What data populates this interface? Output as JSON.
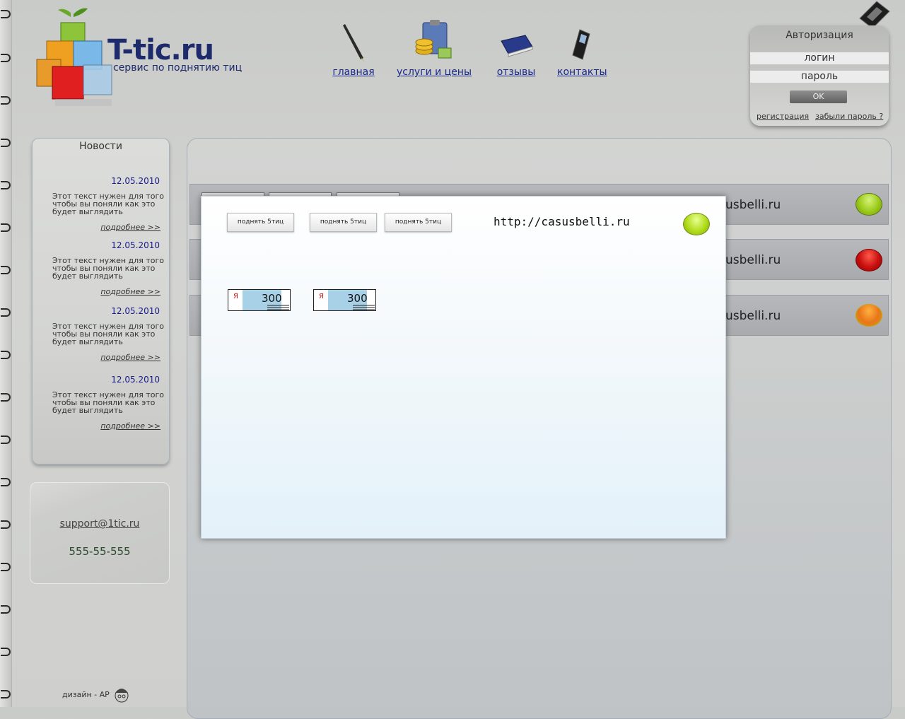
{
  "brand": {
    "name": "T-tic.ru",
    "tagline": "сервис по поднятию тиц"
  },
  "nav": [
    {
      "label": "главная",
      "icon": "pen-icon"
    },
    {
      "label": "услуги и цены",
      "icon": "coins-clipboard-icon"
    },
    {
      "label": "отзывы",
      "icon": "book-icon"
    },
    {
      "label": "контакты",
      "icon": "mobile-phone-icon"
    }
  ],
  "auth": {
    "title": "Авторизация",
    "login_value": "логин",
    "password_value": "пароль",
    "ok_label": "OK",
    "register_link": "регистрация",
    "forgot_link": "забыли пароль ?"
  },
  "news": {
    "title": "Новости",
    "items": [
      {
        "date": "12.05.2010",
        "text": "Этот текст нужен для того чтобы вы поняли как это будет выглядить",
        "more": "подробнее >>"
      },
      {
        "date": "12.05.2010",
        "text": "Этот текст нужен для того чтобы вы поняли как это будет выглядить",
        "more": "подробнее >>"
      },
      {
        "date": "12.05.2010",
        "text": "Этот текст нужен для того чтобы вы поняли как это будет выглядить",
        "more": "подробнее >>"
      },
      {
        "date": "12.05.2010",
        "text": "Этот текст нужен для того чтобы вы поняли как это будет выглядить",
        "more": "подробнее >>"
      }
    ]
  },
  "contact": {
    "email": "support@1tic.ru",
    "phone": "555-55-555"
  },
  "footer": {
    "design": "дизайн - АР"
  },
  "rows": [
    {
      "url_fragment": "usbelli.ru",
      "status": "green"
    },
    {
      "url_fragment": "usbelli.ru",
      "status": "red"
    },
    {
      "url_fragment": "usbelli.ru",
      "status": "orange"
    }
  ],
  "modal": {
    "buttons": [
      "поднять 5тиц",
      "поднять 5тиц",
      "поднять 5тиц"
    ],
    "url": "http://casusbelli.ru",
    "status": "green",
    "badges": [
      {
        "logo": "Я",
        "value": "300"
      },
      {
        "logo": "Я",
        "value": "300"
      }
    ]
  },
  "colors": {
    "nav_link": "#1a2a88",
    "date": "#1a1a8a",
    "brand": "#1d2a6b"
  }
}
